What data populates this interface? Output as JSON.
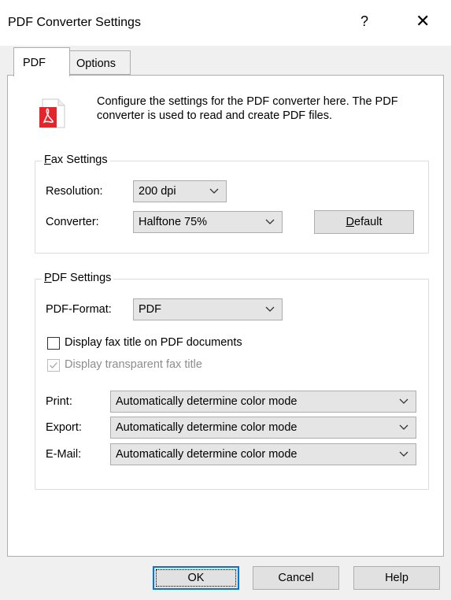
{
  "window": {
    "title": "PDF Converter Settings",
    "help_glyph": "?",
    "close_glyph": "✕"
  },
  "tabs": [
    {
      "label": "PDF",
      "active": true
    },
    {
      "label": "Options",
      "active": false
    }
  ],
  "intro": {
    "icon": "pdf-document-icon",
    "text": "Configure the settings for the PDF converter here. The PDF converter is used to read and create PDF files."
  },
  "fax_settings": {
    "legend_u": "F",
    "legend_rest": "ax Settings",
    "resolution_label": "Resolution:",
    "resolution_value": "200 dpi",
    "converter_label": "Converter:",
    "converter_value": "Halftone 75%",
    "default_button_u": "D",
    "default_button_rest": "efault"
  },
  "pdf_settings": {
    "legend_u": "P",
    "legend_rest": "DF Settings",
    "format_label": "PDF-Format:",
    "format_value": "PDF",
    "display_fax_title_label": "Display fax title on PDF documents",
    "display_fax_title_checked": false,
    "display_transparent_label": "Display transparent fax title",
    "display_transparent_checked": true,
    "display_transparent_enabled": false,
    "print_label": "Print:",
    "print_value": "Automatically determine color mode",
    "export_label": "Export:",
    "export_value": "Automatically determine color mode",
    "email_label": "E-Mail:",
    "email_value": "Automatically determine color mode"
  },
  "footer": {
    "ok": "OK",
    "cancel": "Cancel",
    "help": "Help"
  },
  "colors": {
    "pdf_red": "#e3262b",
    "disabled_text": "#8d8d8d",
    "focus_border": "#0078d7"
  }
}
